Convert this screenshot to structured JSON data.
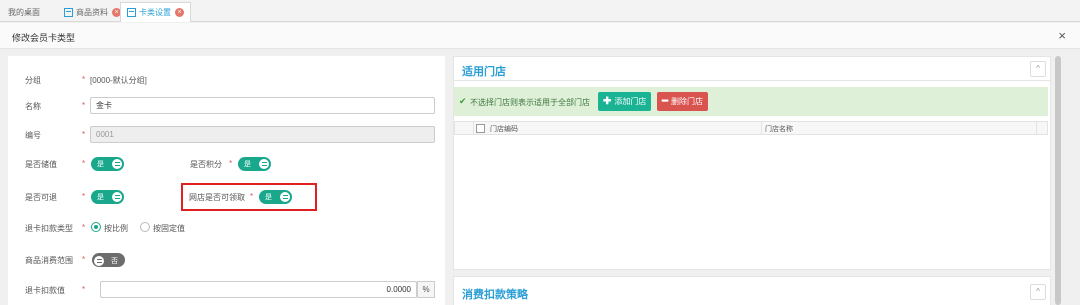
{
  "tabs": [
    {
      "label": "我的桌面",
      "icon": "",
      "closable": false,
      "active": false
    },
    {
      "label": "商品资料",
      "icon": "table-icon",
      "closable": true,
      "active": false
    },
    {
      "label": "卡类设置",
      "icon": "table-icon",
      "closable": true,
      "active": true
    }
  ],
  "header": {
    "title": "修改会员卡类型",
    "close_glyph": "×"
  },
  "form": {
    "group": {
      "label": "分组",
      "value": "[0000-默认分组]"
    },
    "name": {
      "label": "名称",
      "value": "金卡"
    },
    "code": {
      "label": "编号",
      "value": "0001"
    },
    "stored_value": {
      "label": "是否储值",
      "toggle": "是",
      "on": true
    },
    "points": {
      "label": "是否积分",
      "toggle": "是",
      "on": true
    },
    "refundable": {
      "label": "是否可退",
      "toggle": "是",
      "on": true
    },
    "online_claim": {
      "label": "网店是否可领取",
      "toggle": "是",
      "on": true
    },
    "refund_type": {
      "label": "退卡扣款类型",
      "options": [
        "按比例",
        "按固定值"
      ],
      "selected": "按比例"
    },
    "consume_range": {
      "label": "商品消费范围",
      "toggle": "否",
      "on": false
    },
    "refund_amount": {
      "label": "退卡扣款值",
      "value": "0.0000",
      "unit": "%"
    },
    "required_mark": "*"
  },
  "stores_panel": {
    "title": "适用门店",
    "collapse_glyph": "^",
    "notice": "不选择门店则表示适用于全部门店",
    "check_glyph": "✔",
    "add_button": "添加门店",
    "add_glyph": "✚",
    "delete_button": "删除门店",
    "delete_glyph": "━",
    "columns": [
      "门店编码",
      "门店名称"
    ]
  },
  "strategy_panel": {
    "title": "消费扣款策略",
    "collapse_glyph": "^"
  },
  "colors": {
    "accent": "#2a9fd6",
    "toggle_on": "#1aa88c",
    "add": "#1ab394",
    "delete": "#d9534f",
    "highlight": "#e02020"
  }
}
